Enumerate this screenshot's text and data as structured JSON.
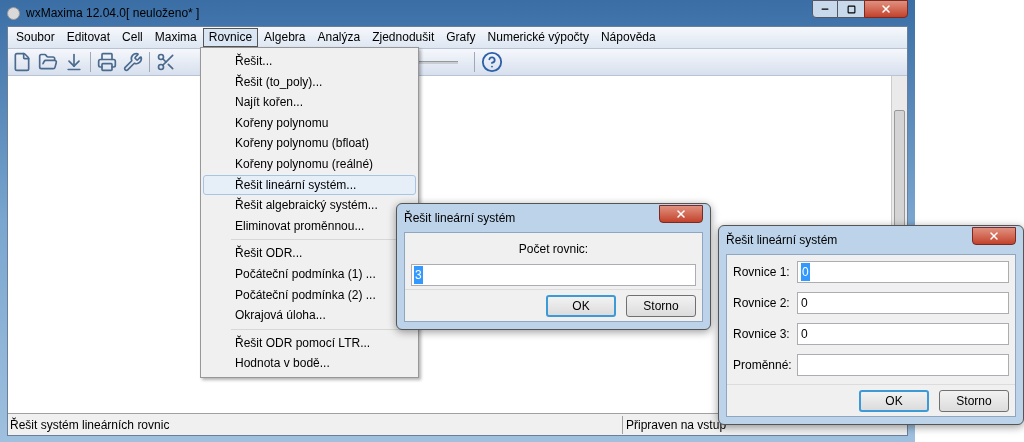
{
  "window": {
    "title": "wxMaxima 12.04.0[ neuloženo* ]"
  },
  "menu_bar": [
    {
      "label": "Soubor",
      "selected": false
    },
    {
      "label": "Editovat",
      "selected": false
    },
    {
      "label": "Cell",
      "selected": false
    },
    {
      "label": "Maxima",
      "selected": false
    },
    {
      "label": "Rovnice",
      "selected": true
    },
    {
      "label": "Algebra",
      "selected": false
    },
    {
      "label": "Analýza",
      "selected": false
    },
    {
      "label": "Zjednodušit",
      "selected": false
    },
    {
      "label": "Grafy",
      "selected": false
    },
    {
      "label": "Numerické výpočty",
      "selected": false
    },
    {
      "label": "Nápověda",
      "selected": false
    }
  ],
  "dropdown_menu": {
    "items": [
      {
        "kind": "item",
        "label": "Řešit...",
        "selected": false
      },
      {
        "kind": "item",
        "label": "Řešit (to_poly)...",
        "selected": false
      },
      {
        "kind": "item",
        "label": "Najít kořen...",
        "selected": false
      },
      {
        "kind": "item",
        "label": "Kořeny polynomu",
        "selected": false
      },
      {
        "kind": "item",
        "label": "Kořeny polynomu (bfloat)",
        "selected": false
      },
      {
        "kind": "item",
        "label": "Kořeny polynomu (reálné)",
        "selected": false
      },
      {
        "kind": "item",
        "label": "Řešit lineární systém...",
        "selected": true
      },
      {
        "kind": "item",
        "label": "Řešit algebraický systém...",
        "selected": false
      },
      {
        "kind": "item",
        "label": "Eliminovat proměnnou...",
        "selected": false
      },
      {
        "kind": "separator"
      },
      {
        "kind": "item",
        "label": "Řešit ODR...",
        "selected": false
      },
      {
        "kind": "item",
        "label": "Počáteční podmínka (1) ...",
        "selected": false
      },
      {
        "kind": "item",
        "label": "Počáteční podmínka (2) ...",
        "selected": false
      },
      {
        "kind": "item",
        "label": "Okrajová úloha...",
        "selected": false
      },
      {
        "kind": "separator"
      },
      {
        "kind": "item",
        "label": "Řešit ODR pomocí LTR...",
        "selected": false
      },
      {
        "kind": "item",
        "label": "Hodnota v bodě...",
        "selected": false
      }
    ]
  },
  "status_bar": {
    "message": "Řešit systém lineárních rovnic",
    "state": "Připraven na vstup"
  },
  "count_dialog": {
    "title": "Řešit lineární systém",
    "label": "Počet rovnic:",
    "field": {
      "value": "3",
      "text_selected": true
    },
    "buttons": [
      {
        "label": "OK",
        "default": true
      },
      {
        "label": "Storno",
        "default": false
      }
    ]
  },
  "equations_dialog": {
    "title": "Řešit lineární systém",
    "fields": [
      {
        "label": "Rovnice 1:",
        "value": "0",
        "text_selected": true
      },
      {
        "label": "Rovnice 2:",
        "value": "0",
        "text_selected": false
      },
      {
        "label": "Rovnice 3:",
        "value": "0",
        "text_selected": false
      },
      {
        "label": "Proměnné:"
      }
    ],
    "buttons": [
      {
        "label": "OK",
        "default": true
      },
      {
        "label": "Storno",
        "default": false
      }
    ]
  }
}
